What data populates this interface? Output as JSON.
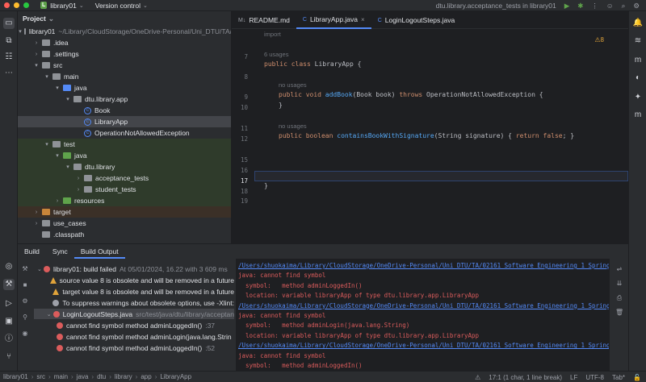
{
  "titlebar": {
    "project_badge": "L",
    "project_name": "library01",
    "vcs": "Version control",
    "run_config": "dtu.library.acceptance_tests in library01"
  },
  "project_panel": {
    "title": "Project",
    "root_name": "library01",
    "root_path": "~/Library/CloudStorage/OneDrive-Personal/Uni_DTU/TA/",
    "items": [
      {
        "label": "library01",
        "level": 0,
        "arrow": "▾",
        "folder": "plain"
      },
      {
        "label": ".idea",
        "level": 1,
        "arrow": "›",
        "folder": "plain"
      },
      {
        "label": ".settings",
        "level": 1,
        "arrow": "›",
        "folder": "plain"
      },
      {
        "label": "src",
        "level": 1,
        "arrow": "▾",
        "folder": "plain"
      },
      {
        "label": "main",
        "level": 2,
        "arrow": "▾",
        "folder": "plain"
      },
      {
        "label": "java",
        "level": 3,
        "arrow": "▾",
        "folder": "blue"
      },
      {
        "label": "dtu.library.app",
        "level": 4,
        "arrow": "▾",
        "folder": "plain"
      },
      {
        "label": "Book",
        "level": 5,
        "arrow": "",
        "folder": "class"
      },
      {
        "label": "LibraryApp",
        "level": 5,
        "arrow": "",
        "folder": "class"
      },
      {
        "label": "OperationNotAllowedException",
        "level": 5,
        "arrow": "",
        "folder": "class"
      },
      {
        "label": "test",
        "level": 2,
        "arrow": "▾",
        "folder": "plain"
      },
      {
        "label": "java",
        "level": 3,
        "arrow": "▾",
        "folder": "green"
      },
      {
        "label": "dtu.library",
        "level": 4,
        "arrow": "▾",
        "folder": "plain"
      },
      {
        "label": "acceptance_tests",
        "level": 5,
        "arrow": "›",
        "folder": "plain"
      },
      {
        "label": "student_tests",
        "level": 5,
        "arrow": "›",
        "folder": "plain"
      },
      {
        "label": "resources",
        "level": 3,
        "arrow": "›",
        "folder": "green"
      },
      {
        "label": "target",
        "level": 1,
        "arrow": "›",
        "folder": "orange"
      },
      {
        "label": "use_cases",
        "level": 1,
        "arrow": "›",
        "folder": "plain"
      },
      {
        "label": ".classpath",
        "level": 1,
        "arrow": "",
        "folder": "plain"
      }
    ]
  },
  "editor": {
    "tabs": [
      {
        "icon": "M↓",
        "label": "README.md",
        "active": false
      },
      {
        "icon": "C",
        "label": "LibraryApp.java",
        "active": true
      },
      {
        "icon": "C",
        "label": "LoginLogoutSteps.java",
        "active": false
      }
    ],
    "warnings": "⚠8",
    "top_fragment": "import",
    "usages_1": "6 usages",
    "usages_2": "no usages",
    "usages_3": "no usages",
    "line_numbers": [
      "7",
      "8",
      "9",
      "10",
      "11",
      "12",
      "15",
      "16",
      "17",
      "18",
      "19"
    ],
    "line7": "public class LibraryApp {",
    "line9": "public void addBook(Book book) throws OperationNotAllowedException {",
    "line10": "}",
    "line12": "public boolean containsBookWithSignature(String signature) { return false; }",
    "line18": "}"
  },
  "bottom_panel": {
    "tabs": [
      "Build",
      "Sync",
      "Build Output"
    ],
    "tree": [
      {
        "icon": "error",
        "text": "library01: build failed",
        "dim": "At 05/01/2024, 16.22 with 3  609 ms",
        "indent": 0
      },
      {
        "icon": "warn",
        "text": "source value 8 is obsolete and will be removed in a future",
        "dim": "",
        "indent": 1
      },
      {
        "icon": "warn",
        "text": "target value 8 is obsolete and will be removed in a future",
        "dim": "",
        "indent": 1
      },
      {
        "icon": "info",
        "text": "To suppress warnings about obsolete options, use -Xlint:",
        "dim": "",
        "indent": 1
      },
      {
        "icon": "error",
        "text": "LoginLogoutSteps.java",
        "dim": "src/test/java/dtu/library/acceptan",
        "indent": 1
      },
      {
        "icon": "error",
        "text": "cannot find symbol method adminLoggedIn()",
        "dim": ":37",
        "indent": 2
      },
      {
        "icon": "error",
        "text": "cannot find symbol method adminLogin(java.lang.Strin",
        "dim": "",
        "indent": 2
      },
      {
        "icon": "error",
        "text": "cannot find symbol method adminLoggedIn()",
        "dim": ":52",
        "indent": 2
      }
    ],
    "output": [
      {
        "t": "/Users/shuokaima/Library/CloudStorage/OneDrive-Personal/Uni_DTU/TA/02161 Software Engineering 1 Spring 2",
        "link": true
      },
      {
        "t": "java: cannot find symbol",
        "link": false
      },
      {
        "t": "  symbol:   method adminLoggedIn()",
        "link": false
      },
      {
        "t": "  location: variable libraryApp of type dtu.library.app.LibraryApp",
        "link": false
      },
      {
        "t": "/Users/shuokaima/Library/CloudStorage/OneDrive-Personal/Uni_DTU/TA/02161 Software Engineering 1 Spring 2",
        "link": true
      },
      {
        "t": "java: cannot find symbol",
        "link": false
      },
      {
        "t": "  symbol:   method adminLogin(java.lang.String)",
        "link": false
      },
      {
        "t": "  location: variable libraryApp of type dtu.library.app.LibraryApp",
        "link": false
      },
      {
        "t": "/Users/shuokaima/Library/CloudStorage/OneDrive-Personal/Uni_DTU/TA/02161 Software Engineering 1 Spring 2",
        "link": true
      },
      {
        "t": "java: cannot find symbol",
        "link": false
      },
      {
        "t": "  symbol:   method adminLoggedIn()",
        "link": false
      }
    ]
  },
  "statusbar": {
    "breadcrumbs": [
      "library01",
      "src",
      "main",
      "java",
      "dtu",
      "library",
      "app",
      "LibraryApp"
    ],
    "position": "17:1 (1 char, 1 line break)",
    "line_sep": "LF",
    "encoding": "UTF-8",
    "indent": "Tab*"
  },
  "colors": {
    "accent": "#548af7",
    "error": "#db5c5c",
    "warning": "#e0a33a",
    "success": "#5fa34b"
  }
}
